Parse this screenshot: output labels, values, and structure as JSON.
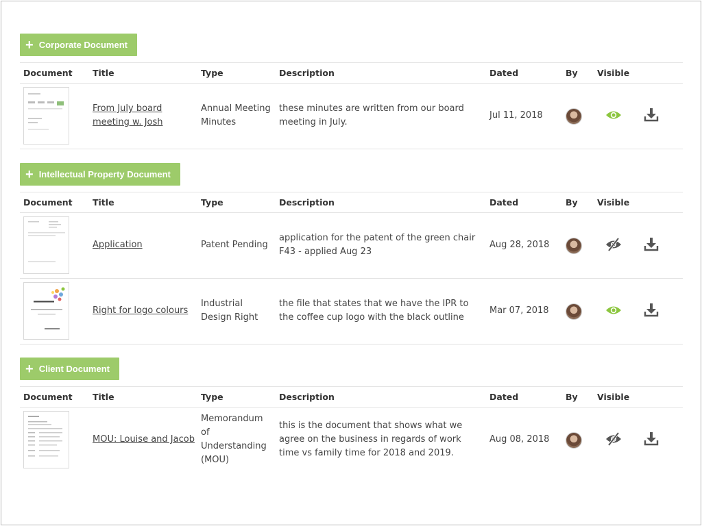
{
  "colors": {
    "accent": "#9dcb6a",
    "visible_on": "#8cc63f",
    "visible_off": "#555555"
  },
  "headers": {
    "document": "Document",
    "title": "Title",
    "type": "Type",
    "description": "Description",
    "dated": "Dated",
    "by": "By",
    "visible": "Visible"
  },
  "sections": [
    {
      "button": {
        "plus": "+",
        "label": "Corporate Document"
      },
      "rows": [
        {
          "title_lines": [
            "From July board",
            "meeting w. Josh"
          ],
          "type_lines": [
            "Annual Meeting",
            "Minutes"
          ],
          "desc_lines": [
            "these minutes are written from our board",
            "meeting in July."
          ],
          "dated": "Jul 11, 2018",
          "visible": true
        }
      ]
    },
    {
      "button": {
        "plus": "+",
        "label": "Intellectual Property Document"
      },
      "rows": [
        {
          "title_lines": [
            "Application"
          ],
          "type_lines": [
            "Patent Pending"
          ],
          "desc_lines": [
            "application for the patent of the green chair",
            "F43 - applied Aug 23"
          ],
          "dated": "Aug 28, 2018",
          "visible": false
        },
        {
          "title_lines": [
            "Right for logo colours"
          ],
          "type_lines": [
            "Industrial",
            "Design Right"
          ],
          "desc_lines": [
            "the file that states that we have the IPR to",
            "the coffee cup logo with the black outline"
          ],
          "dated": "Mar 07, 2018",
          "visible": true
        }
      ]
    },
    {
      "button": {
        "plus": "+",
        "label": "Client Document"
      },
      "rows": [
        {
          "title_lines": [
            "MOU: Louise and Jacob"
          ],
          "type_lines": [
            "Memorandum",
            "of",
            "Understanding",
            "(MOU)"
          ],
          "desc_lines": [
            "this is the document that shows what we",
            "agree on the business in regards of work",
            "time vs family time for 2018 and 2019."
          ],
          "dated": "Aug 08, 2018",
          "visible": false
        }
      ]
    }
  ],
  "icons": {
    "by": "user-avatar",
    "visible_on": "eye-icon",
    "visible_off": "eye-slash-icon",
    "download": "download-icon"
  }
}
